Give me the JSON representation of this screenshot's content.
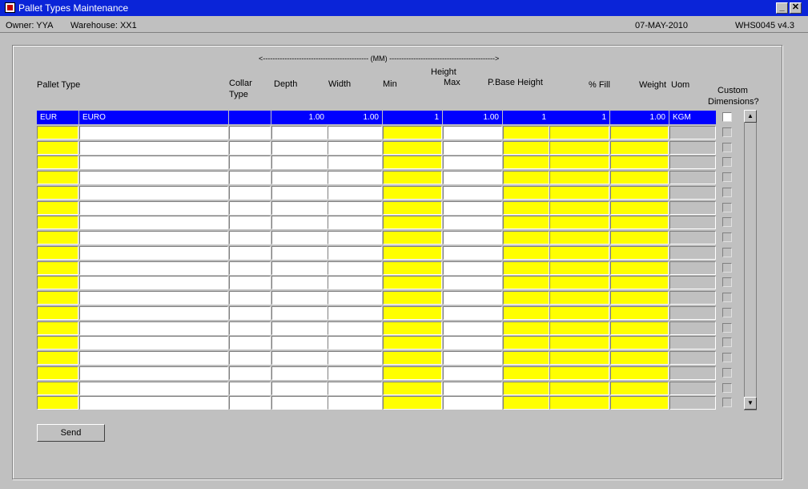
{
  "window": {
    "title": "Pallet Types Maintenance",
    "minimize_glyph": "_",
    "close_glyph": "✕",
    "app_icon": "oracle-forms-icon"
  },
  "infobar": {
    "owner": "Owner:  YYA",
    "warehouse": "Warehouse:  XX1",
    "date": "07-MAY-2010",
    "version": "WHS0045  v4.3"
  },
  "headers": {
    "mm_range": "<-------------------------------------------- (MM) -------------------------------------------->",
    "pallet_type": "Pallet Type",
    "collar_type": "Collar\nType",
    "depth": "Depth",
    "width": "Width",
    "height": "Height",
    "min": "Min",
    "max": "Max",
    "pbase_height": "P.Base Height",
    "fill": "% Fill",
    "weight": "Weight",
    "uom": "Uom",
    "custom_dimensions": "Custom\nDimensions?"
  },
  "rows": [
    {
      "code": "EUR",
      "description": "EURO",
      "collar": "",
      "depth": "1.00",
      "width": "1.00",
      "min": "1",
      "max": "1.00",
      "pbase": "1",
      "fill": "1",
      "weight": "1.00",
      "uom": "KGM",
      "custom": false
    }
  ],
  "total_rows": 20,
  "scrollbar": {
    "up_glyph": "▲",
    "down_glyph": "▼"
  },
  "send_label": "Send"
}
